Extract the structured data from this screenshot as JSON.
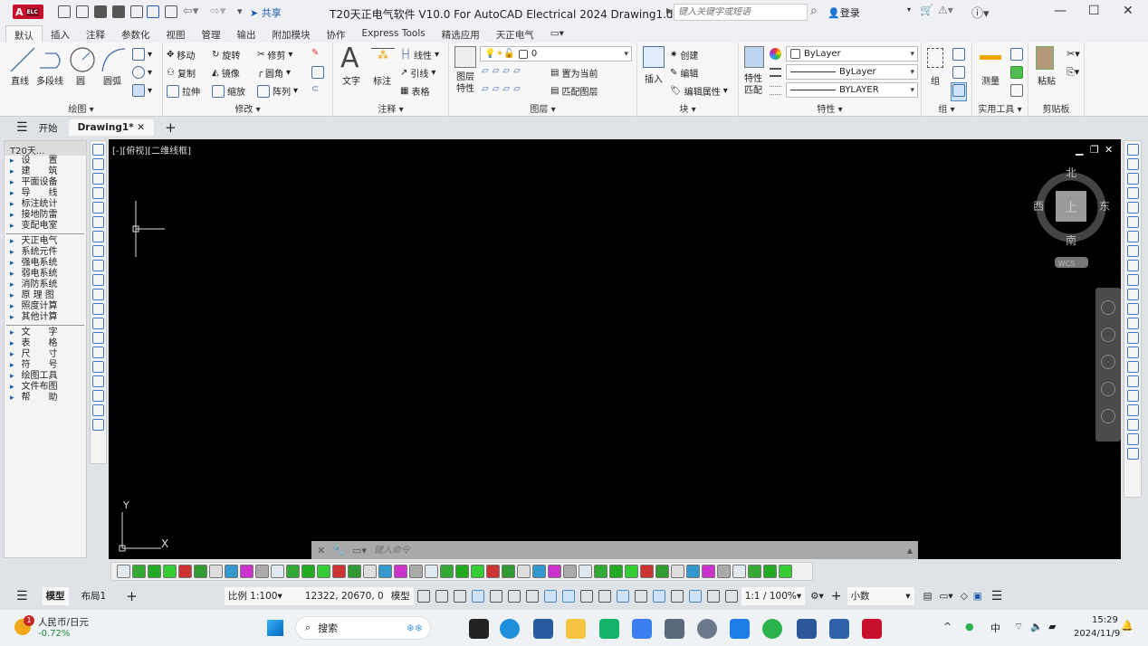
{
  "titlebar": {
    "logo": "A",
    "logo_sub": "ELC",
    "share": "共享",
    "title": "T20天正电气软件 V10.0 For AutoCAD Electrical 2024   Drawing1.dwg",
    "search_placeholder": "键入关键字或短语",
    "login": "登录"
  },
  "ribbon_tabs": [
    "默认",
    "插入",
    "注释",
    "参数化",
    "视图",
    "管理",
    "输出",
    "附加模块",
    "协作",
    "Express Tools",
    "精选应用",
    "天正电气"
  ],
  "ribbon": {
    "draw": {
      "label": "绘图",
      "items": [
        "直线",
        "多段线",
        "圆",
        "圆弧"
      ]
    },
    "modify": {
      "label": "修改",
      "items": [
        "移动",
        "旋转",
        "修剪",
        "复制",
        "镜像",
        "圆角",
        "拉伸",
        "缩放",
        "阵列"
      ]
    },
    "annotate": {
      "label": "注释",
      "items": [
        "文字",
        "标注",
        "线性",
        "引线",
        "表格"
      ]
    },
    "layers": {
      "label": "图层",
      "layer_props": "图层\n特性",
      "current_layer": "0",
      "set_current": "置为当前",
      "match_layer": "匹配图层"
    },
    "block": {
      "label": "块",
      "insert": "插入",
      "create": "创建",
      "edit": "编辑",
      "edit_attr": "编辑属性"
    },
    "properties": {
      "label": "特性",
      "match": "特性\n匹配",
      "color": "ByLayer",
      "linetype": "ByLayer",
      "lineweight": "BYLAYER"
    },
    "groups": {
      "label": "组",
      "group": "组"
    },
    "utilities": {
      "label": "实用工具",
      "measure": "测量"
    },
    "clipboard": {
      "label": "剪贴板",
      "paste": "粘贴"
    }
  },
  "doctabs": {
    "start": "开始",
    "drawing": "Drawing1*"
  },
  "palette": {
    "title": "T20天...",
    "groups": [
      [
        "设　　置",
        "建　　筑",
        "平面设备",
        "导　　线",
        "标注统计",
        "接地防雷",
        "变配电室"
      ],
      [
        "天正电气",
        "系统元件",
        "强电系统",
        "弱电系统",
        "消防系统",
        "原 理 图",
        "照度计算",
        "其他计算"
      ],
      [
        "文　　字",
        "表　　格",
        "尺　　寸",
        "符　　号",
        "绘图工具",
        "文件布图",
        "帮　　助"
      ]
    ]
  },
  "canvas": {
    "view_label": "[-][俯视][二维线框]",
    "compass": {
      "north": "北",
      "south": "南",
      "east": "东",
      "west": "西",
      "top": "上",
      "wcs": "WCS"
    },
    "ucs_x": "X",
    "ucs_y": "Y"
  },
  "command": {
    "placeholder": "键入命令"
  },
  "status": {
    "model_tab": "模型",
    "layout_tab": "布局1",
    "scale": "比例 1:100",
    "coords": "12322, 20670, 0",
    "model": "模型",
    "anno_scale": "1:1 / 100%",
    "units": "小数"
  },
  "taskbar": {
    "widget_title": "人民币/日元",
    "widget_value": "-0.72%",
    "widget_badge": "1",
    "search": "搜索",
    "ime": "中",
    "time": "15:29",
    "date": "2024/11/9"
  },
  "colors": {
    "accent": "#1c5bb0",
    "canvas": "#000000",
    "logo": "#c8102e",
    "widget_negative": "#1a8a3a"
  }
}
